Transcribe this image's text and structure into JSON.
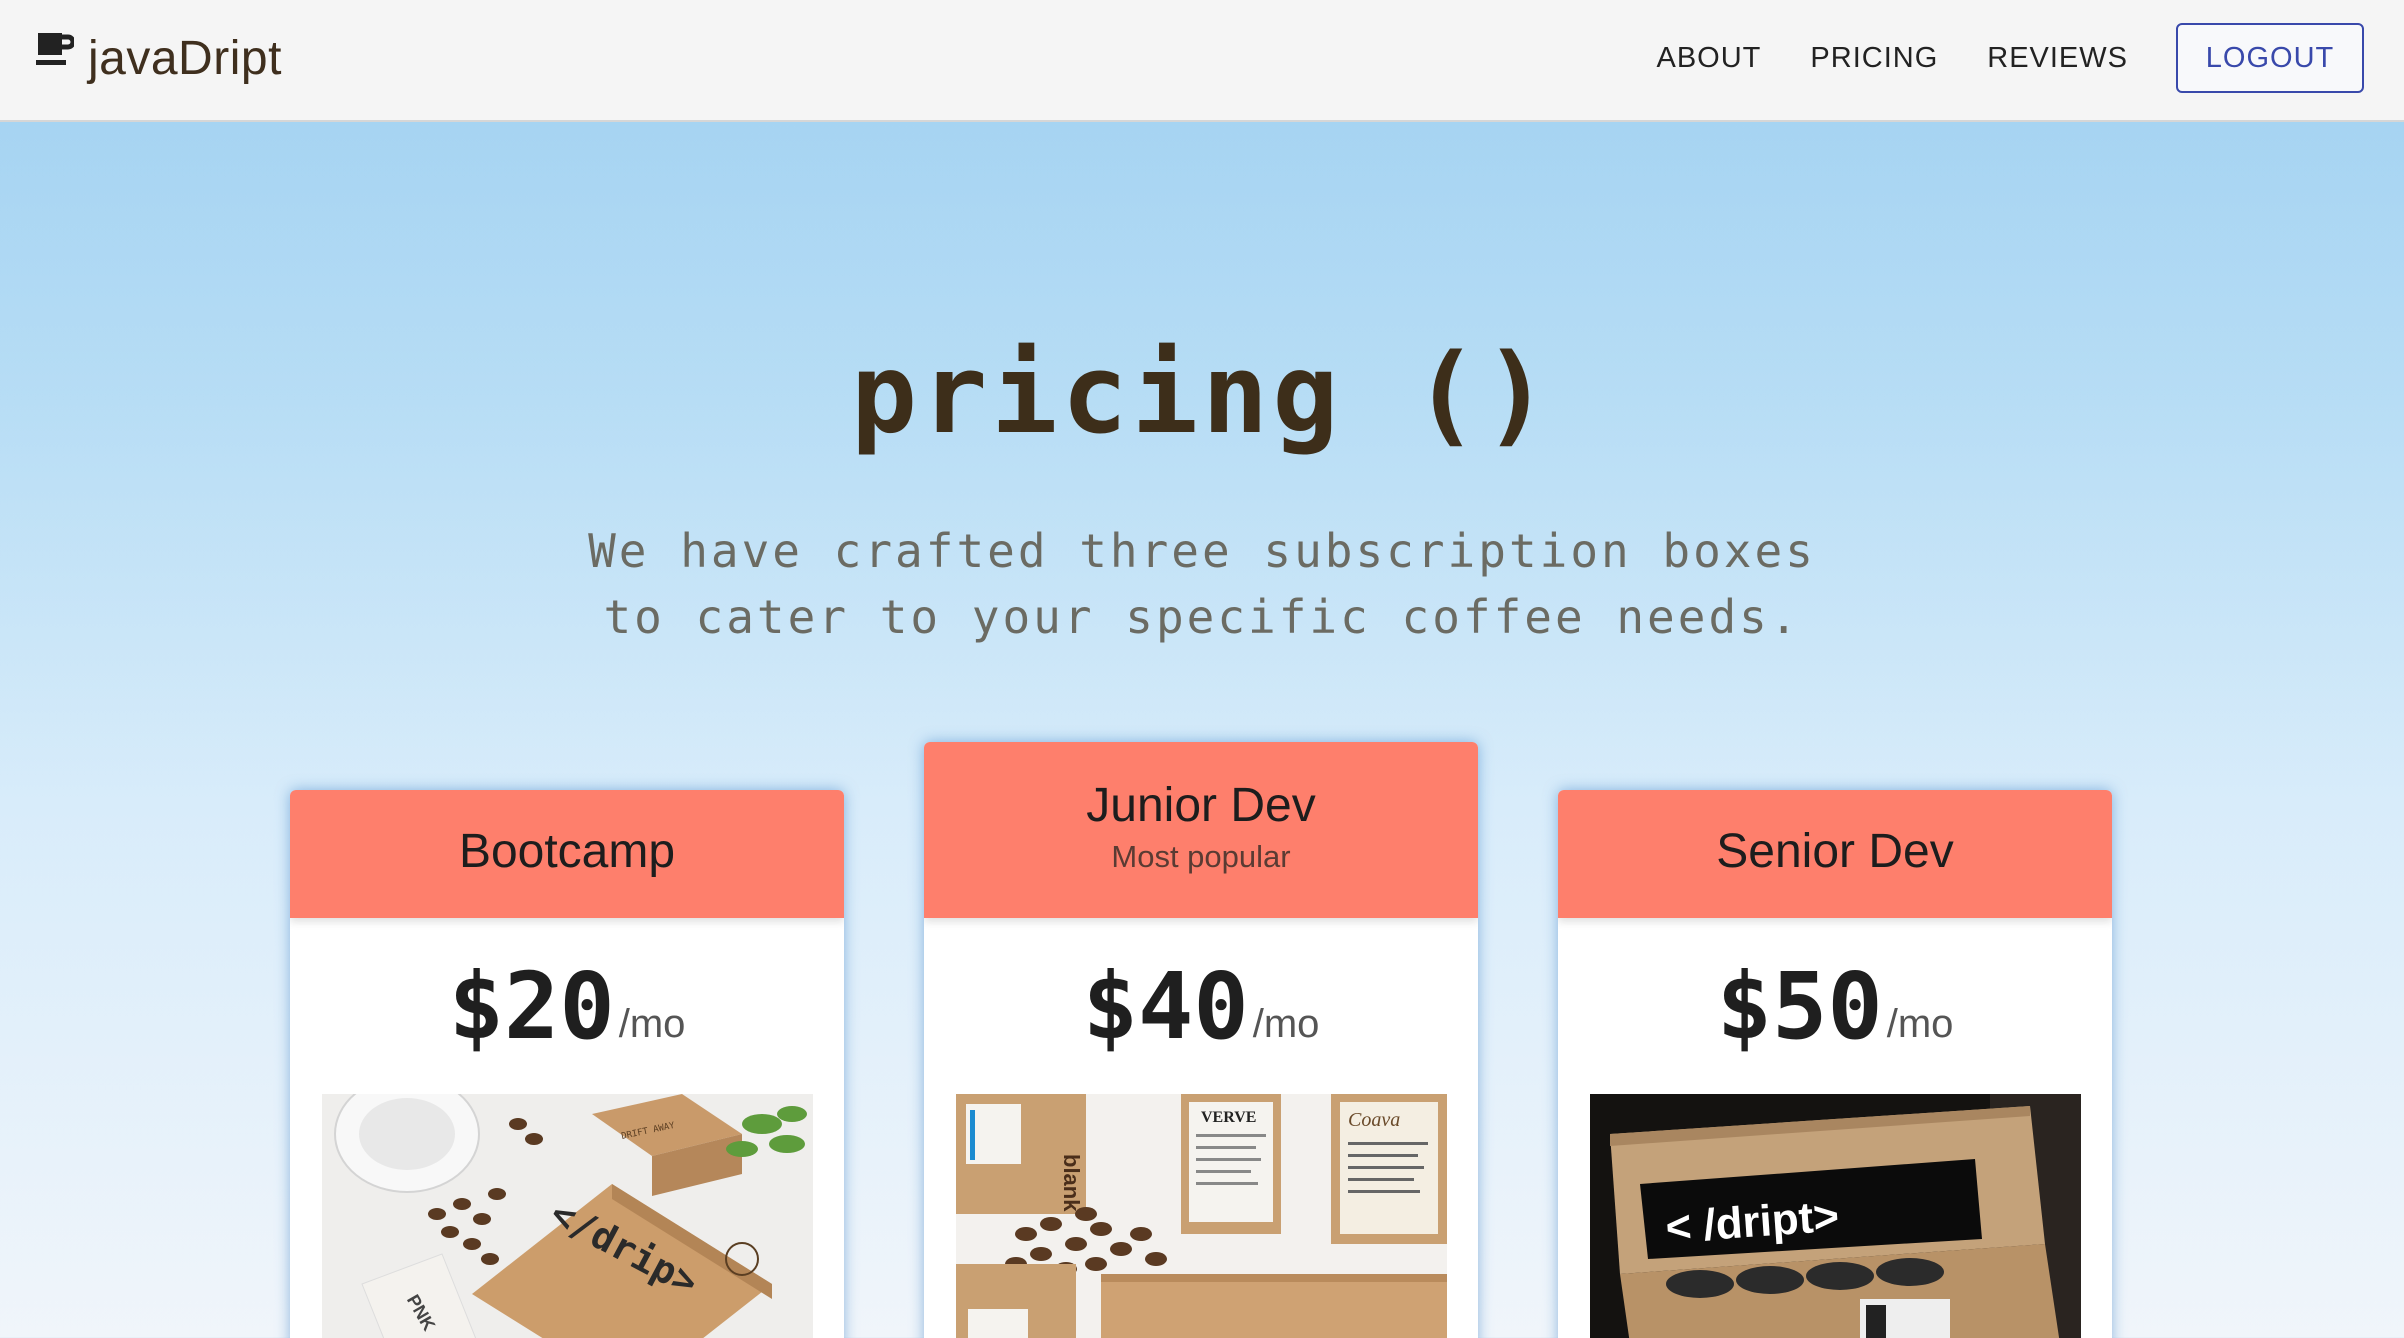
{
  "brand": {
    "name": "javaDript",
    "icon": "coffee-cup-icon"
  },
  "nav": {
    "about": "ABOUT",
    "pricing": "PRICING",
    "reviews": "REVIEWS",
    "logout": "LOGOUT"
  },
  "hero": {
    "title": "pricing ()",
    "subtitle_line1": "We have crafted three subscription boxes",
    "subtitle_line2": "to cater to your specific coffee needs."
  },
  "plans": [
    {
      "name": "Bootcamp",
      "tag": "",
      "price": "$20",
      "period": "/mo",
      "box_label": "</drip>",
      "bag_label": "PNK",
      "bag_label2": "DRIFT AWAY"
    },
    {
      "name": "Junior Dev",
      "tag": "Most popular",
      "price": "$40",
      "period": "/mo",
      "bag_labels": [
        "blank",
        "VERVE",
        "Coava"
      ]
    },
    {
      "name": "Senior Dev",
      "tag": "",
      "price": "$50",
      "period": "/mo",
      "box_label": "< /dript>"
    }
  ],
  "colors": {
    "card_header": "#fe7f6c",
    "accent": "#3949ab",
    "brand_text": "#3f2f1e"
  }
}
